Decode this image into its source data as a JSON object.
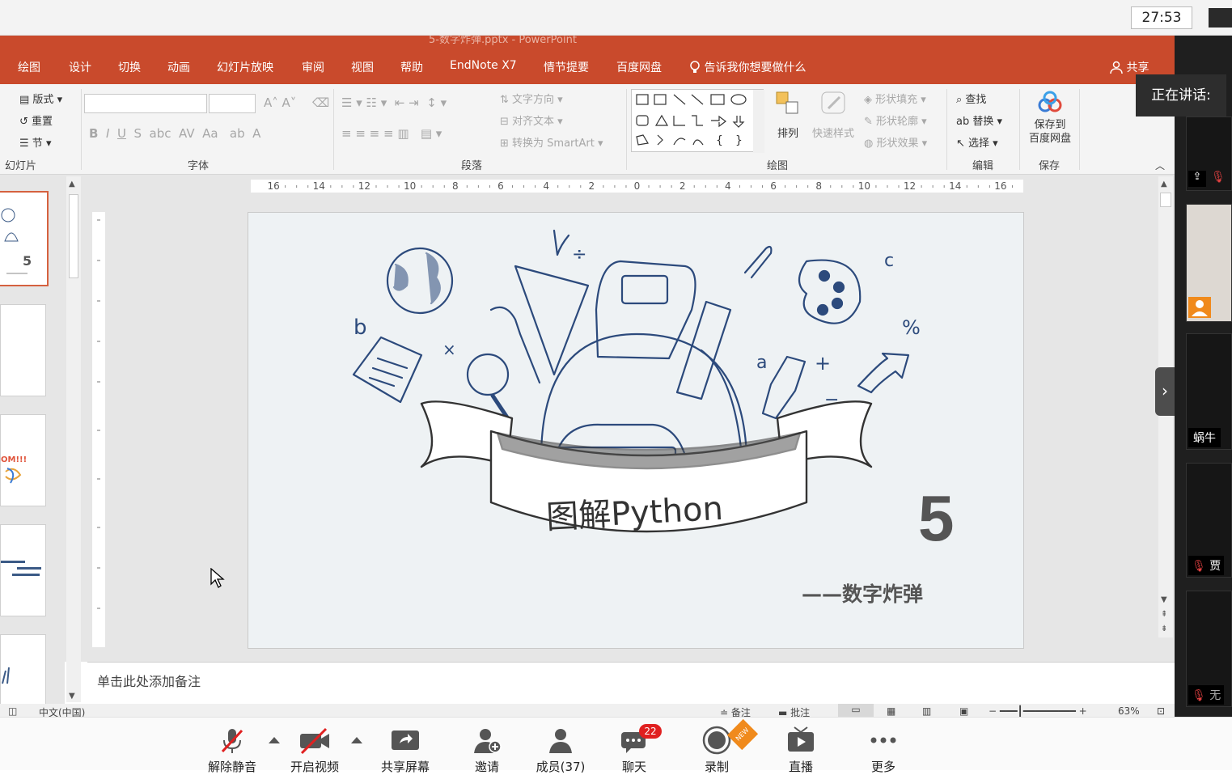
{
  "timer": "27:53",
  "window_title": "5-数字炸弹.pptx  -  PowerPoint",
  "ribbon_tabs": [
    "绘图",
    "设计",
    "切换",
    "动画",
    "幻灯片放映",
    "审阅",
    "视图",
    "帮助",
    "EndNote X7",
    "情节提要",
    "百度网盘"
  ],
  "tell_me": "告诉我你想要做什么",
  "share": "共享",
  "ribbon": {
    "slides_group": {
      "layout": "版式",
      "reset": "重置",
      "section": "节",
      "label": "幻灯片"
    },
    "font_group": {
      "label": "字体"
    },
    "paragraph_group": {
      "text_direction": "文字方向",
      "align_text": "对齐文本",
      "smartart": "转换为 SmartArt",
      "label": "段落"
    },
    "drawing_group": {
      "arrange": "排列",
      "quick_styles": "快速样式",
      "shape_fill": "形状填充",
      "shape_outline": "形状轮廓",
      "shape_effects": "形状效果",
      "label": "绘图"
    },
    "editing_group": {
      "find": "查找",
      "replace": "替换",
      "select": "选择",
      "label": "编辑"
    },
    "save_group": {
      "save_to_1": "保存到",
      "save_to_2": "百度网盘",
      "label": "保存"
    }
  },
  "ruler_labels": [
    "16",
    "14",
    "12",
    "10",
    "8",
    "6",
    "4",
    "2",
    "0",
    "2",
    "4",
    "6",
    "8",
    "10",
    "12",
    "14",
    "16"
  ],
  "slide": {
    "title": "图解Python",
    "number": "5",
    "subtitle": "——数字炸弹"
  },
  "notes_placeholder": "单击此处添加备注",
  "status": {
    "language": "中文(中国)",
    "notes": "备注",
    "comments": "批注",
    "zoom": "63%"
  },
  "gallery": {
    "speaking": "正在讲话:",
    "p1": "蜗牛",
    "p2": "贾",
    "p3": "无"
  },
  "bottom": {
    "unmute": "解除静音",
    "start_video": "开启视频",
    "share_screen": "共享屏幕",
    "invite": "邀请",
    "members": "成员(37)",
    "chat": "聊天",
    "chat_badge": "22",
    "record": "录制",
    "live": "直播",
    "more": "更多",
    "new_tag": "NEW"
  }
}
